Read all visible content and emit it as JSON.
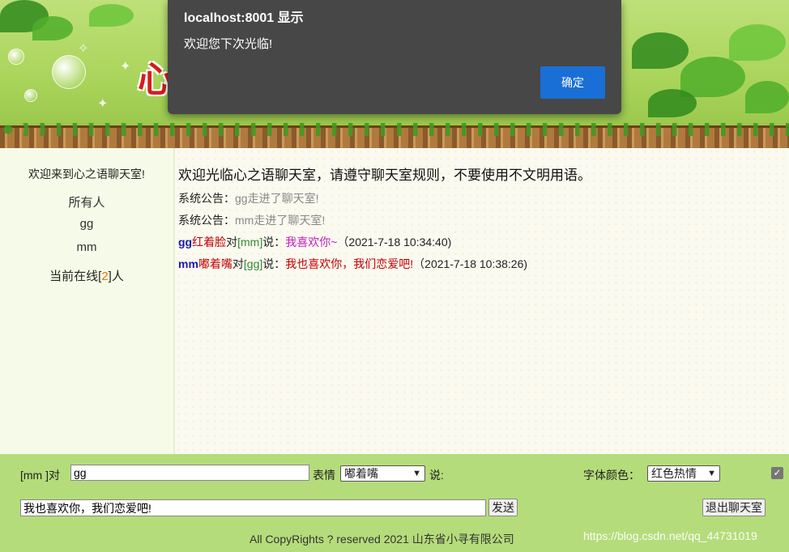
{
  "dialog": {
    "title": "localhost:8001 显示",
    "message": "欢迎您下次光临!",
    "ok_label": "确定"
  },
  "sidebar": {
    "welcome": "欢迎来到心之语聊天室!",
    "users": [
      "所有人",
      "gg",
      "mm"
    ],
    "online_prefix": "当前在线[",
    "online_count": "2",
    "online_suffix": "]人"
  },
  "chat": {
    "rules": "欢迎光临心之语聊天室，请遵守聊天室规则，不要使用不文明用语。",
    "system_label": "系统公告：",
    "system_messages": [
      "gg走进了聊天室!",
      "mm走进了聊天室!"
    ],
    "messages": [
      {
        "sender": "gg",
        "expression": "红着脸",
        "to_word": "对",
        "target": "[mm]",
        "said": "说：",
        "text": "我喜欢你~",
        "time": "（2021-7-18 10:34:40)",
        "text_color": "#c020c0"
      },
      {
        "sender": "mm",
        "expression": "嘟着嘴",
        "to_word": "对",
        "target": "[gg]",
        "said": "说：",
        "text": "我也喜欢你，我们恋爱吧!",
        "time": "（2021-7-18 10:38:26)",
        "text_color": "#c40000"
      }
    ]
  },
  "bottom": {
    "speaker_label": "[mm ]对",
    "target_value": "gg",
    "expression_label": "表情",
    "expression_selected": "嘟着嘴",
    "say_label": "说:",
    "font_color_label": "字体颜色：",
    "font_color_selected": "红色热情",
    "message_value": "我也喜欢你，我们恋爱吧!",
    "send_label": "发送",
    "exit_label": "退出聊天室",
    "checkbox_checked": true,
    "copyright": "All CopyRights ? reserved 2021 山东省小寻有限公司",
    "watermark": "https://blog.csdn.net/qq_44731019"
  },
  "colors": {
    "dialog_bg": "#474747",
    "dialog_button": "#1a6fd6",
    "bottom_bg": "#b5dc7a",
    "sidebar_bg": "#f5fbe8"
  }
}
